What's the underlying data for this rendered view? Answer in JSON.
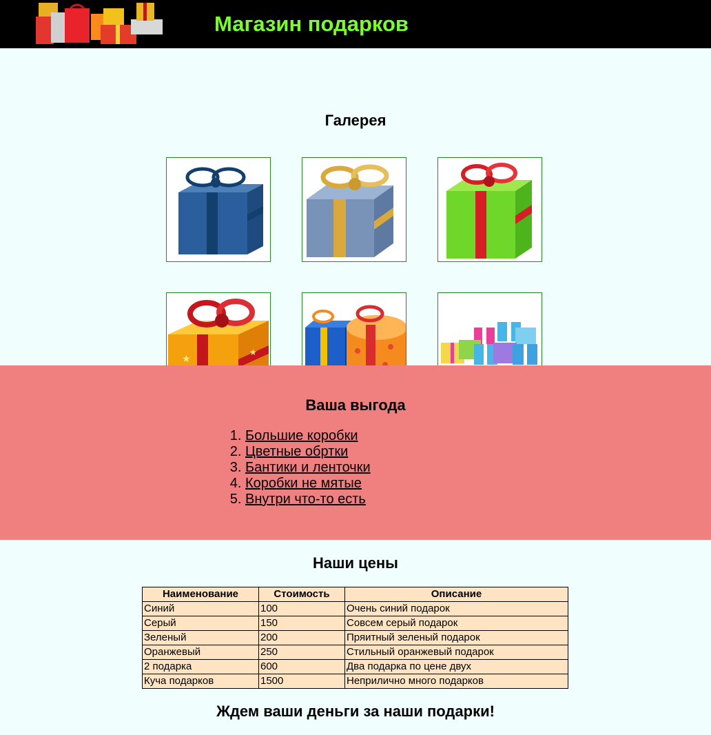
{
  "header": {
    "site_title": "Магазин подарков",
    "logo_icon": "gift-bags-logo-icon"
  },
  "gallery": {
    "title": "Галерея",
    "items": [
      {
        "icon": "blue-gift-box-icon",
        "ribbon": "#12406e",
        "box": "#2a5e9c"
      },
      {
        "icon": "gray-blue-gift-box-icon",
        "ribbon": "#d9a93c",
        "box": "#7892b8"
      },
      {
        "icon": "green-gift-box-icon",
        "ribbon": "#d41f25",
        "box": "#6fd62a"
      },
      {
        "icon": "orange-star-gift-box-icon",
        "ribbon": "#c3161d",
        "box": "#f5a10e"
      },
      {
        "icon": "two-gift-boxes-icon",
        "ribbon": "#d92c2c",
        "box": "#f58a1f"
      },
      {
        "icon": "pile-of-small-gifts-icon",
        "ribbon": "#e8409a",
        "box": "#47b6e6"
      }
    ]
  },
  "benefits": {
    "title": "Ваша выгода",
    "items": [
      "Большие коробки",
      "Цветные обртки",
      "Бантики и ленточки",
      "Коробки не мятые",
      "Внутри что-то есть"
    ]
  },
  "prices": {
    "title": "Наши цены",
    "headers": [
      "Наименование",
      "Стоимость",
      "Описание"
    ],
    "rows": [
      [
        "Синий",
        "100",
        "Очень синий подарок"
      ],
      [
        "Серый",
        "150",
        "Совсем серый подарок"
      ],
      [
        "Зеленый",
        "200",
        "Пряитный зеленый подарок"
      ],
      [
        "Оранжевый",
        "250",
        "Стильный оранжевый подарок"
      ],
      [
        "2 подарка",
        "600",
        "Два подарка по цене двух"
      ],
      [
        "Куча подарков",
        "1500",
        "Неприлично много подарков"
      ]
    ]
  },
  "footer": {
    "note": "Ждем ваши деньги за наши подарки!"
  },
  "colors": {
    "header_bg": "#000000",
    "title_green": "#7cfc2a",
    "page_bg": "#f0fffe",
    "benefits_bg": "#f08080",
    "table_bg": "#ffe4c4",
    "thumb_border": "#228b22"
  }
}
